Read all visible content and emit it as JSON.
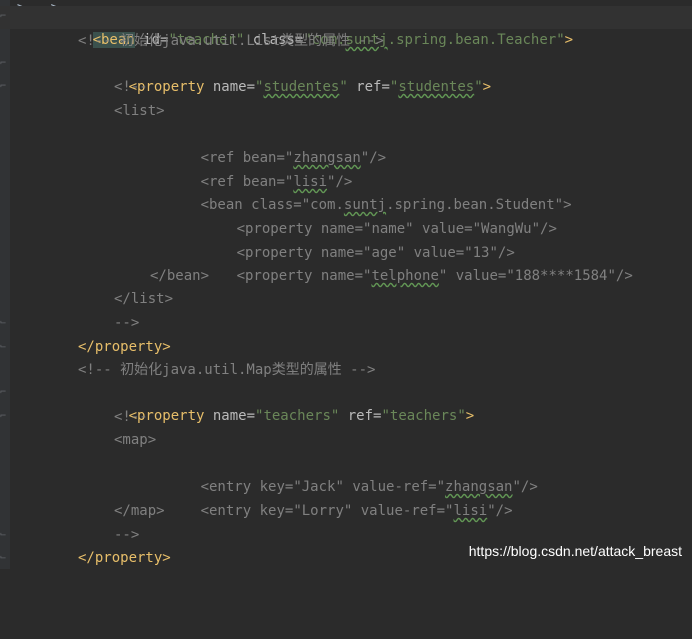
{
  "watermark": "https://blog.csdn.net/attack_breast",
  "lines": [
    {
      "t1": "<bean",
      "t2": " id=",
      "t3": "\"teacher\"",
      "t4": " class=",
      "t5": "\"com.",
      "t6": "suntj",
      "t7": ".spring.bean.Teacher\"",
      "t8": ">"
    },
    {
      "c": "<!-- 初始化java.util.List类型的属性 -->"
    },
    {
      "t1": "<property",
      "t2": " name=",
      "t3a": "\"",
      "t3": "studentes",
      "t3b": "\"",
      "t4": " ref=",
      "t5a": "\"",
      "t5": "studentes",
      "t5b": "\"",
      "t6": ">"
    },
    {
      "c": "<!--"
    },
    {
      "t1": "<list>"
    },
    {
      "t1": "<ref",
      "t2": " bean=",
      "t3a": "\"",
      "t3": "zhangsan",
      "t3b": "\"",
      "t4": "/>"
    },
    {
      "t1": "<ref",
      "t2": " bean=",
      "t3a": "\"",
      "t3": "lisi",
      "t3b": "\"",
      "t4": "/>"
    },
    {
      "t1": "<bean",
      "t2": " class=",
      "t3a": "\"com.",
      "t3": "suntj",
      "t3b": ".spring.bean.Student\"",
      "t4": ">"
    },
    {
      "t1": "<property",
      "t2": " name=",
      "t3": "\"name\"",
      "t4": " value=",
      "t5": "\"WangWu\"",
      "t6": "/>"
    },
    {
      "t1": "<property",
      "t2": " name=",
      "t3": "\"age\"",
      "t4": " value=",
      "t5": "\"13\"",
      "t6": "/>"
    },
    {
      "t1": "<property",
      "t2": " name=",
      "t3a": "\"",
      "t3": "telphone",
      "t3b": "\"",
      "t4": " value=",
      "t5": "\"188****1584\"",
      "t6": "/>"
    },
    {
      "t1": "</bean>"
    },
    {
      "t1": "</list>"
    },
    {
      "c": "-->"
    },
    {
      "t1": "</property>"
    },
    {
      "c": "<!-- 初始化java.util.Map类型的属性 -->"
    },
    {
      "t1": "<property",
      "t2": " name=",
      "t3": "\"teachers\"",
      "t4": " ref=",
      "t5": "\"teachers\"",
      "t6": ">"
    },
    {
      "c": "<!--"
    },
    {
      "t1": "<map>"
    },
    {
      "t1": "<entry",
      "t2": " key=",
      "t3": "\"Jack\"",
      "t4": " value-ref=",
      "t5a": "\"",
      "t5": "zhangsan",
      "t5b": "\"",
      "t6": "/>"
    },
    {
      "t1": "<entry",
      "t2": " key=",
      "t3": "\"Lorry\"",
      "t4": " value-ref=",
      "t5a": "\"",
      "t5": "lisi",
      "t5b": "\"",
      "t6": "/>"
    },
    {
      "t1": "</map>"
    },
    {
      "c": "-->"
    },
    {
      "t1": "</property>"
    }
  ]
}
